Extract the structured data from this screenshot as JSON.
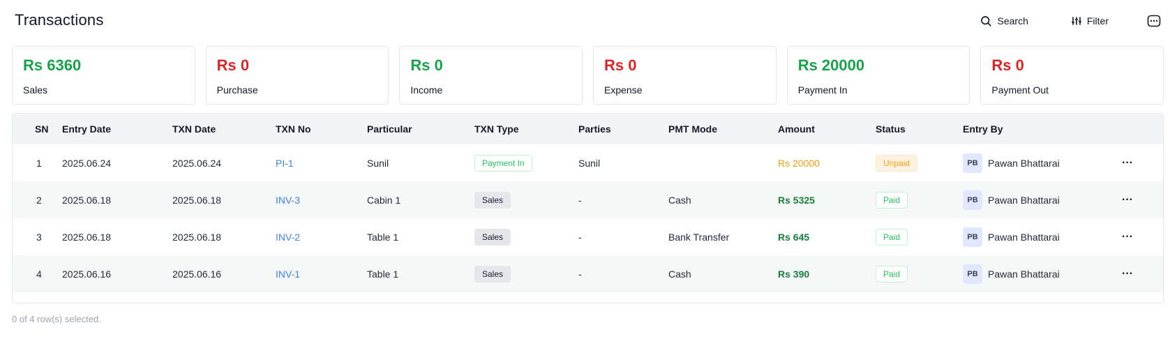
{
  "header": {
    "title": "Transactions",
    "search_label": "Search",
    "filter_label": "Filter"
  },
  "colors": {
    "positive": "#16a34a",
    "negative": "#dc2626",
    "link": "#3b82f6",
    "pending": "#f59e0b"
  },
  "summary": [
    {
      "value": "Rs 6360",
      "label": "Sales",
      "tone": "green"
    },
    {
      "value": "Rs 0",
      "label": "Purchase",
      "tone": "red"
    },
    {
      "value": "Rs 0",
      "label": "Income",
      "tone": "green"
    },
    {
      "value": "Rs 0",
      "label": "Expense",
      "tone": "red"
    },
    {
      "value": "Rs 20000",
      "label": "Payment In",
      "tone": "green"
    },
    {
      "value": "Rs 0",
      "label": "Payment Out",
      "tone": "red"
    }
  ],
  "table": {
    "columns": [
      "SN",
      "Entry Date",
      "TXN Date",
      "TXN No",
      "Particular",
      "TXN Type",
      "Parties",
      "PMT Mode",
      "Amount",
      "Status",
      "Entry By"
    ],
    "rows": [
      {
        "sn": "1",
        "entry_date": "2025.06.24",
        "txn_date": "2025.06.24",
        "txn_no": "PI-1",
        "particular": "Sunil",
        "txn_type": "Payment In",
        "parties": "Sunil",
        "pmt_mode": "",
        "amount": "Rs 20000",
        "status": "Unpaid",
        "initials": "PB",
        "entry_by": "Pawan Bhattarai"
      },
      {
        "sn": "2",
        "entry_date": "2025.06.18",
        "txn_date": "2025.06.18",
        "txn_no": "INV-3",
        "particular": "Cabin 1",
        "txn_type": "Sales",
        "parties": "-",
        "pmt_mode": "Cash",
        "amount": "Rs 5325",
        "status": "Paid",
        "initials": "PB",
        "entry_by": "Pawan Bhattarai"
      },
      {
        "sn": "3",
        "entry_date": "2025.06.18",
        "txn_date": "2025.06.18",
        "txn_no": "INV-2",
        "particular": "Table 1",
        "txn_type": "Sales",
        "parties": "-",
        "pmt_mode": "Bank Transfer",
        "amount": "Rs 645",
        "status": "Paid",
        "initials": "PB",
        "entry_by": "Pawan Bhattarai"
      },
      {
        "sn": "4",
        "entry_date": "2025.06.16",
        "txn_date": "2025.06.16",
        "txn_no": "INV-1",
        "particular": "Table 1",
        "txn_type": "Sales",
        "parties": "-",
        "pmt_mode": "Cash",
        "amount": "Rs 390",
        "status": "Paid",
        "initials": "PB",
        "entry_by": "Pawan Bhattarai"
      }
    ]
  },
  "footer": {
    "selection_text": "0 of 4 row(s) selected."
  },
  "icons": {
    "search": "search-icon",
    "filter": "filter-icon",
    "more": "more-options-icon",
    "row_menu": "row-actions-icon"
  }
}
